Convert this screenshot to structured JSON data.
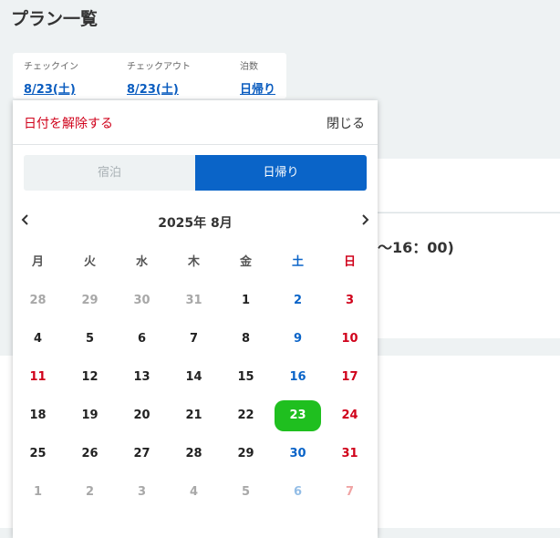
{
  "page": {
    "title": "プラン一覧"
  },
  "stay": {
    "checkin_label": "チェックイン",
    "checkin_value": "8/23(土)",
    "checkout_label": "チェックアウト",
    "checkout_value": "8/23(土)",
    "nights_label": "泊数",
    "nights_value": "日帰り"
  },
  "background": {
    "time_fragment": "〜16：00)"
  },
  "popup": {
    "clear_label": "日付を解除する",
    "close_label": "閉じる",
    "toggle": {
      "stay_label": "宿泊",
      "daytrip_label": "日帰り",
      "active": "daytrip"
    },
    "month_title": "2025年 8月",
    "prev_icon": "chevron-left-icon",
    "next_icon": "chevron-right-icon",
    "weekdays": [
      "月",
      "火",
      "水",
      "木",
      "金",
      "土",
      "日"
    ],
    "weeks": [
      [
        {
          "d": "28",
          "m": 1
        },
        {
          "d": "29",
          "m": 1
        },
        {
          "d": "30",
          "m": 1
        },
        {
          "d": "31",
          "m": 1
        },
        {
          "d": "1",
          "m": 0
        },
        {
          "d": "2",
          "m": 0
        },
        {
          "d": "3",
          "m": 0
        }
      ],
      [
        {
          "d": "4",
          "m": 0
        },
        {
          "d": "5",
          "m": 0
        },
        {
          "d": "6",
          "m": 0
        },
        {
          "d": "7",
          "m": 0
        },
        {
          "d": "8",
          "m": 0
        },
        {
          "d": "9",
          "m": 0
        },
        {
          "d": "10",
          "m": 0
        }
      ],
      [
        {
          "d": "11",
          "m": 0,
          "h": 1
        },
        {
          "d": "12",
          "m": 0
        },
        {
          "d": "13",
          "m": 0
        },
        {
          "d": "14",
          "m": 0
        },
        {
          "d": "15",
          "m": 0
        },
        {
          "d": "16",
          "m": 0
        },
        {
          "d": "17",
          "m": 0
        }
      ],
      [
        {
          "d": "18",
          "m": 0
        },
        {
          "d": "19",
          "m": 0
        },
        {
          "d": "20",
          "m": 0
        },
        {
          "d": "21",
          "m": 0
        },
        {
          "d": "22",
          "m": 0
        },
        {
          "d": "23",
          "m": 0,
          "sel": 1
        },
        {
          "d": "24",
          "m": 0
        }
      ],
      [
        {
          "d": "25",
          "m": 0
        },
        {
          "d": "26",
          "m": 0
        },
        {
          "d": "27",
          "m": 0
        },
        {
          "d": "28",
          "m": 0
        },
        {
          "d": "29",
          "m": 0
        },
        {
          "d": "30",
          "m": 0
        },
        {
          "d": "31",
          "m": 0
        }
      ],
      [
        {
          "d": "1",
          "m": 1
        },
        {
          "d": "2",
          "m": 1
        },
        {
          "d": "3",
          "m": 1
        },
        {
          "d": "4",
          "m": 1
        },
        {
          "d": "5",
          "m": 1
        },
        {
          "d": "6",
          "m": 1
        },
        {
          "d": "7",
          "m": 1
        }
      ]
    ],
    "colors": {
      "primary": "#0a64c8",
      "holiday": "#d0021b",
      "selected": "#1fbf1f"
    }
  }
}
